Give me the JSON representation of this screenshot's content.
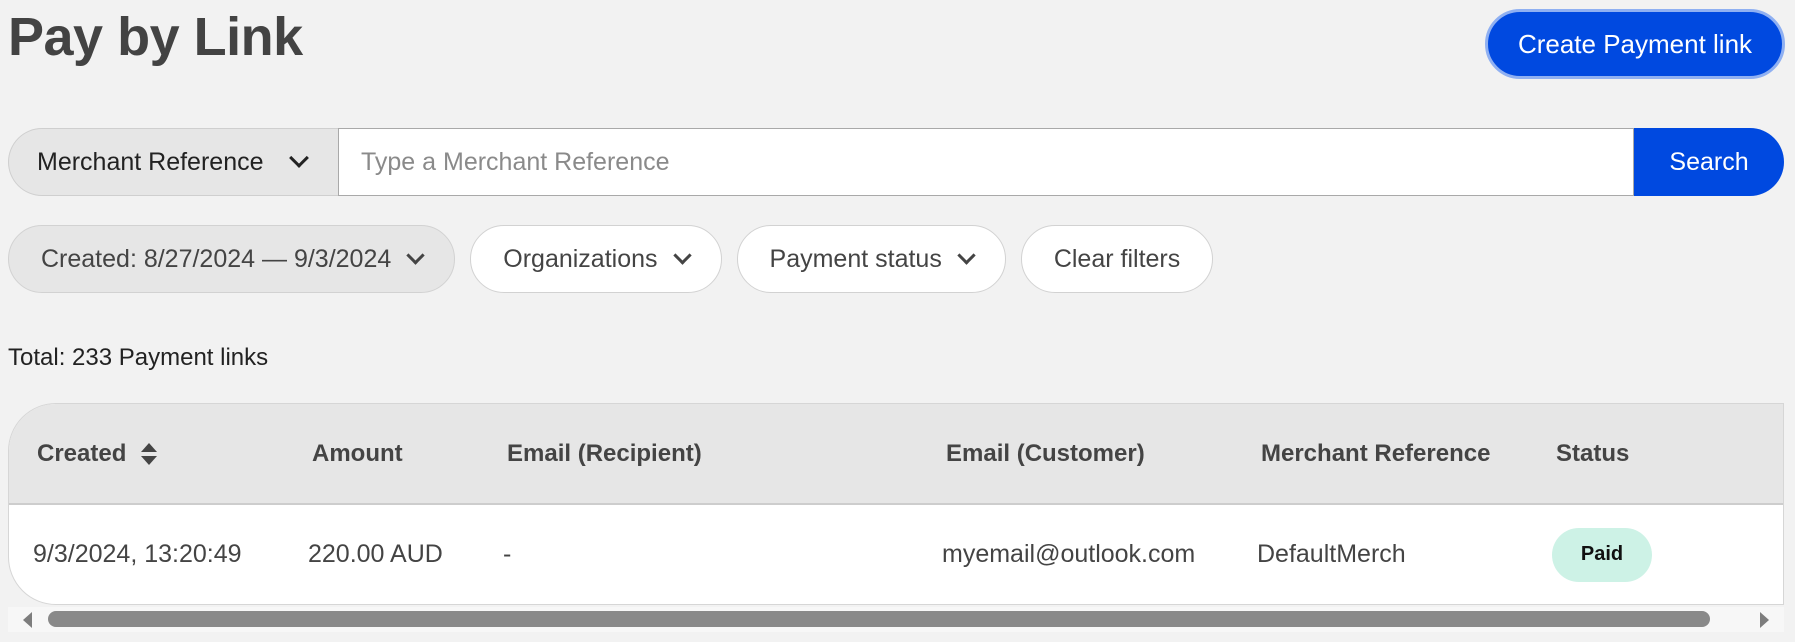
{
  "header": {
    "title": "Pay by Link",
    "create_button": "Create Payment link"
  },
  "search": {
    "field_selected": "Merchant Reference",
    "placeholder": "Type a Merchant Reference",
    "value": "",
    "button": "Search"
  },
  "filters": {
    "created": "Created: 8/27/2024 — 9/3/2024",
    "organizations": "Organizations",
    "payment_status": "Payment status",
    "clear": "Clear filters"
  },
  "summary": {
    "total": "Total: 233 Payment links"
  },
  "table": {
    "columns": [
      "Created",
      "Amount",
      "Email (Recipient)",
      "Email (Customer)",
      "Merchant Reference",
      "Status"
    ],
    "rows": [
      {
        "created": "9/3/2024, 13:20:49",
        "amount": "220.00 AUD",
        "email_recipient": "-",
        "email_customer": "myemail@outlook.com",
        "merchant_reference": "DefaultMerch",
        "status": "Paid"
      }
    ]
  },
  "colors": {
    "primary": "#0049e0",
    "background": "#f2f2f2",
    "header_bg": "#e6e6e6",
    "status_paid_bg": "#cdf2e6"
  }
}
